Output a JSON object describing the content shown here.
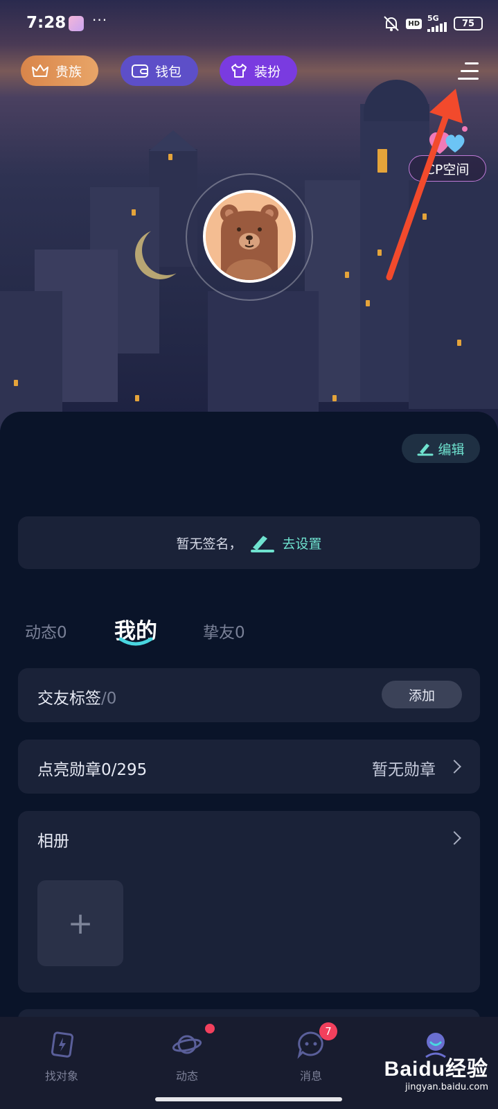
{
  "status_bar": {
    "time": "7:28",
    "dots": "···",
    "hd": "HD",
    "network": "5G",
    "battery": "75"
  },
  "top_buttons": {
    "noble": "贵族",
    "wallet": "钱包",
    "dress_up": "装扮"
  },
  "cp_space": {
    "label": "CP空间"
  },
  "edit": {
    "label": "编辑"
  },
  "signature": {
    "empty_text": "暂无签名，",
    "set_link": "去设置"
  },
  "tabs": [
    {
      "label": "动态0"
    },
    {
      "label": "我的"
    },
    {
      "label": "挚友0"
    }
  ],
  "tags_card": {
    "title": "交友标签",
    "count": "/0",
    "add_button": "添加"
  },
  "medal_card": {
    "title": "点亮勋章0/295",
    "status": "暂无勋章"
  },
  "album_card": {
    "title": "相册",
    "add_symbol": "+"
  },
  "bottom_nav": [
    {
      "label": "找对象",
      "icon": "card-icon"
    },
    {
      "label": "动态",
      "icon": "planet-icon"
    },
    {
      "label": "消息",
      "icon": "chat-icon",
      "badge": "7"
    },
    {
      "label": "",
      "icon": "profile-icon"
    }
  ],
  "watermark": {
    "logo": "Baidu经验",
    "url": "jingyan.baidu.com"
  },
  "colors": {
    "accent": "#6fe2cf",
    "background": "#0a1429",
    "card": "#1a2238",
    "badge": "#f2405d",
    "annotation_arrow": "#f24a2c"
  }
}
